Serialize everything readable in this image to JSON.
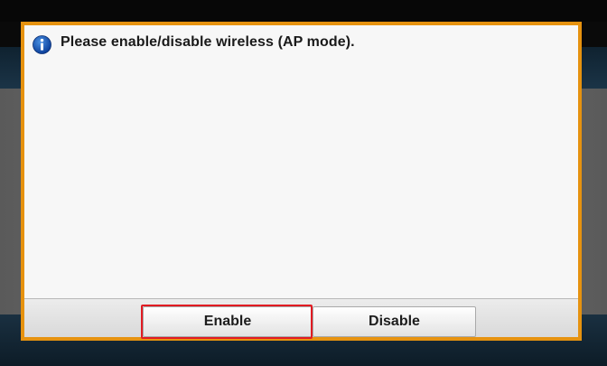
{
  "dialog": {
    "icon": "info-icon",
    "message": "Please enable/disable wireless (AP mode).",
    "accent_color": "#e6920f"
  },
  "buttons": {
    "enable_label": "Enable",
    "disable_label": "Disable",
    "highlight_color": "#e11b22",
    "highlighted": "Enable"
  }
}
